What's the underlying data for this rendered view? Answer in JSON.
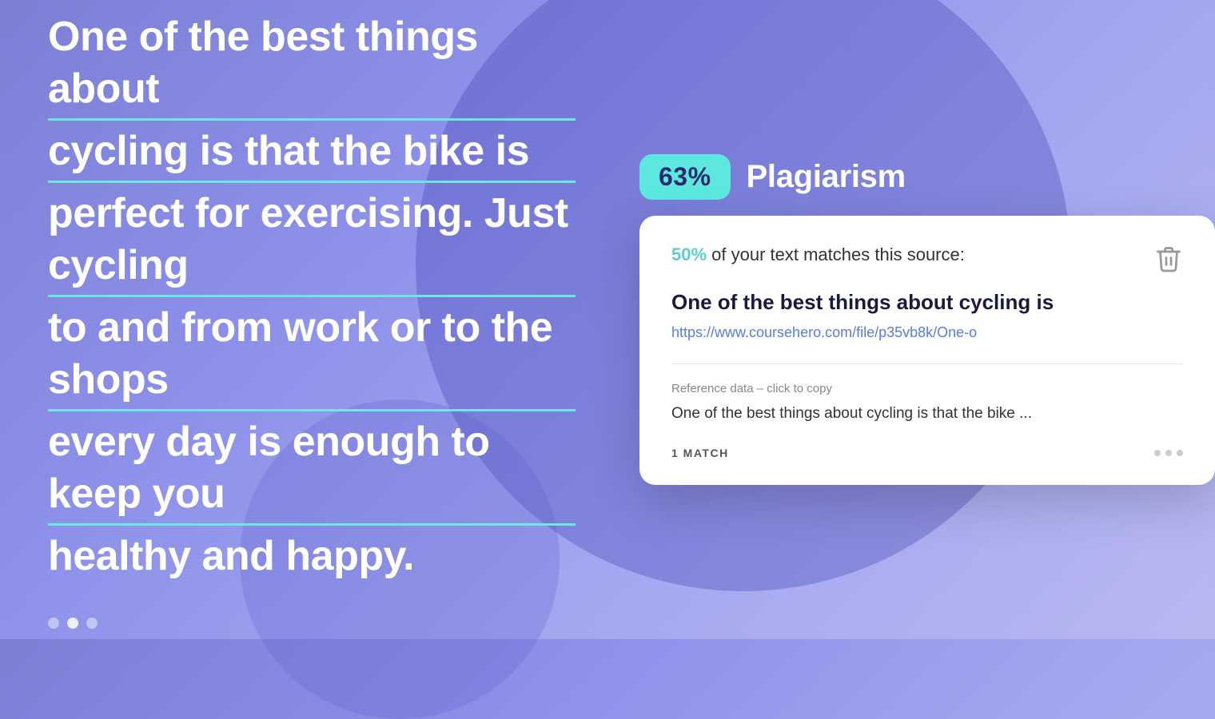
{
  "background": {
    "color_start": "#7b7fd4",
    "color_end": "#b8b8f0"
  },
  "header": {
    "percent_badge": "63%",
    "title": "Plagiarism"
  },
  "text_section": {
    "lines": [
      "One of the best things about",
      "cycling is that the bike is",
      "perfect for exercising. Just cycling",
      "to and from work or to the shops",
      "every day is enough to keep you",
      "healthy and happy."
    ],
    "dots": [
      {
        "active": false
      },
      {
        "active": true
      },
      {
        "active": false
      }
    ]
  },
  "card": {
    "match_percent": "50%",
    "match_text": " of your text matches this source:",
    "source_title": "One of the best things about cycling is",
    "source_url": "https://www.coursehero.com/file/p35vb8k/One-o",
    "reference_label": "Reference data – click to copy",
    "reference_text": "One of the best things about cycling is that the bike ...",
    "match_count": "1 MATCH",
    "trash_icon": "trash"
  }
}
